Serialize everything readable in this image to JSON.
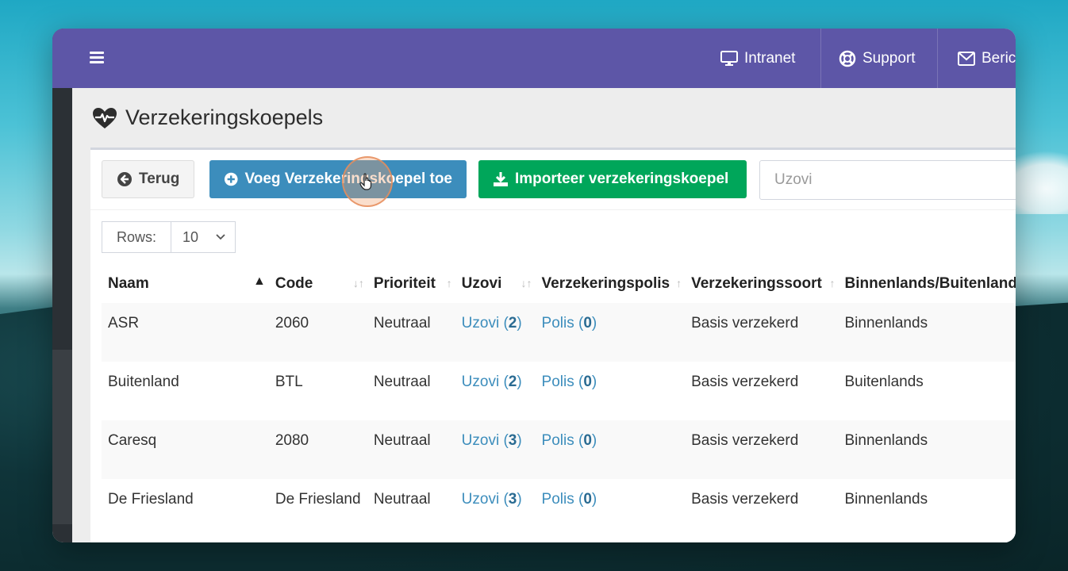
{
  "topbar": {
    "nav": [
      {
        "label": "Intranet",
        "icon": "monitor-icon"
      },
      {
        "label": "Support",
        "icon": "lifebuoy-icon"
      },
      {
        "label": "Berich",
        "icon": "envelope-icon"
      }
    ]
  },
  "page": {
    "title": "Verzekeringskoepels"
  },
  "toolbar": {
    "back_label": "Terug",
    "add_label": "Voeg Verzekeringskoepel toe",
    "import_label": "Importeer verzekeringskoepel",
    "search_placeholder": "Uzovi"
  },
  "rows_control": {
    "label": "Rows:",
    "value": "10"
  },
  "table": {
    "columns": [
      "Naam",
      "Code",
      "Prioriteit",
      "Uzovi",
      "Verzekeringspolis",
      "Verzekeringssoort",
      "Binnenlands/Buitenland"
    ],
    "rows": [
      {
        "naam": "ASR",
        "code": "2060",
        "prioriteit": "Neutraal",
        "uzovi_label": "Uzovi (",
        "uzovi_count": "2",
        "polis_label": "Polis (",
        "polis_count": "0",
        "soort": "Basis verzekerd",
        "land": "Binnenlands"
      },
      {
        "naam": "Buitenland",
        "code": "BTL",
        "prioriteit": "Neutraal",
        "uzovi_label": "Uzovi (",
        "uzovi_count": "2",
        "polis_label": "Polis (",
        "polis_count": "0",
        "soort": "Basis verzekerd",
        "land": "Buitenlands"
      },
      {
        "naam": "Caresq",
        "code": "2080",
        "prioriteit": "Neutraal",
        "uzovi_label": "Uzovi (",
        "uzovi_count": "3",
        "polis_label": "Polis (",
        "polis_count": "0",
        "soort": "Basis verzekerd",
        "land": "Binnenlands"
      },
      {
        "naam": "De Friesland",
        "code": "De Friesland",
        "prioriteit": "Neutraal",
        "uzovi_label": "Uzovi (",
        "uzovi_count": "3",
        "polis_label": "Polis (",
        "polis_count": "0",
        "soort": "Basis verzekerd",
        "land": "Binnenlands"
      }
    ]
  },
  "colors": {
    "topbar": "#5d56a7",
    "primary": "#3c8dbc",
    "success": "#00a65a"
  }
}
